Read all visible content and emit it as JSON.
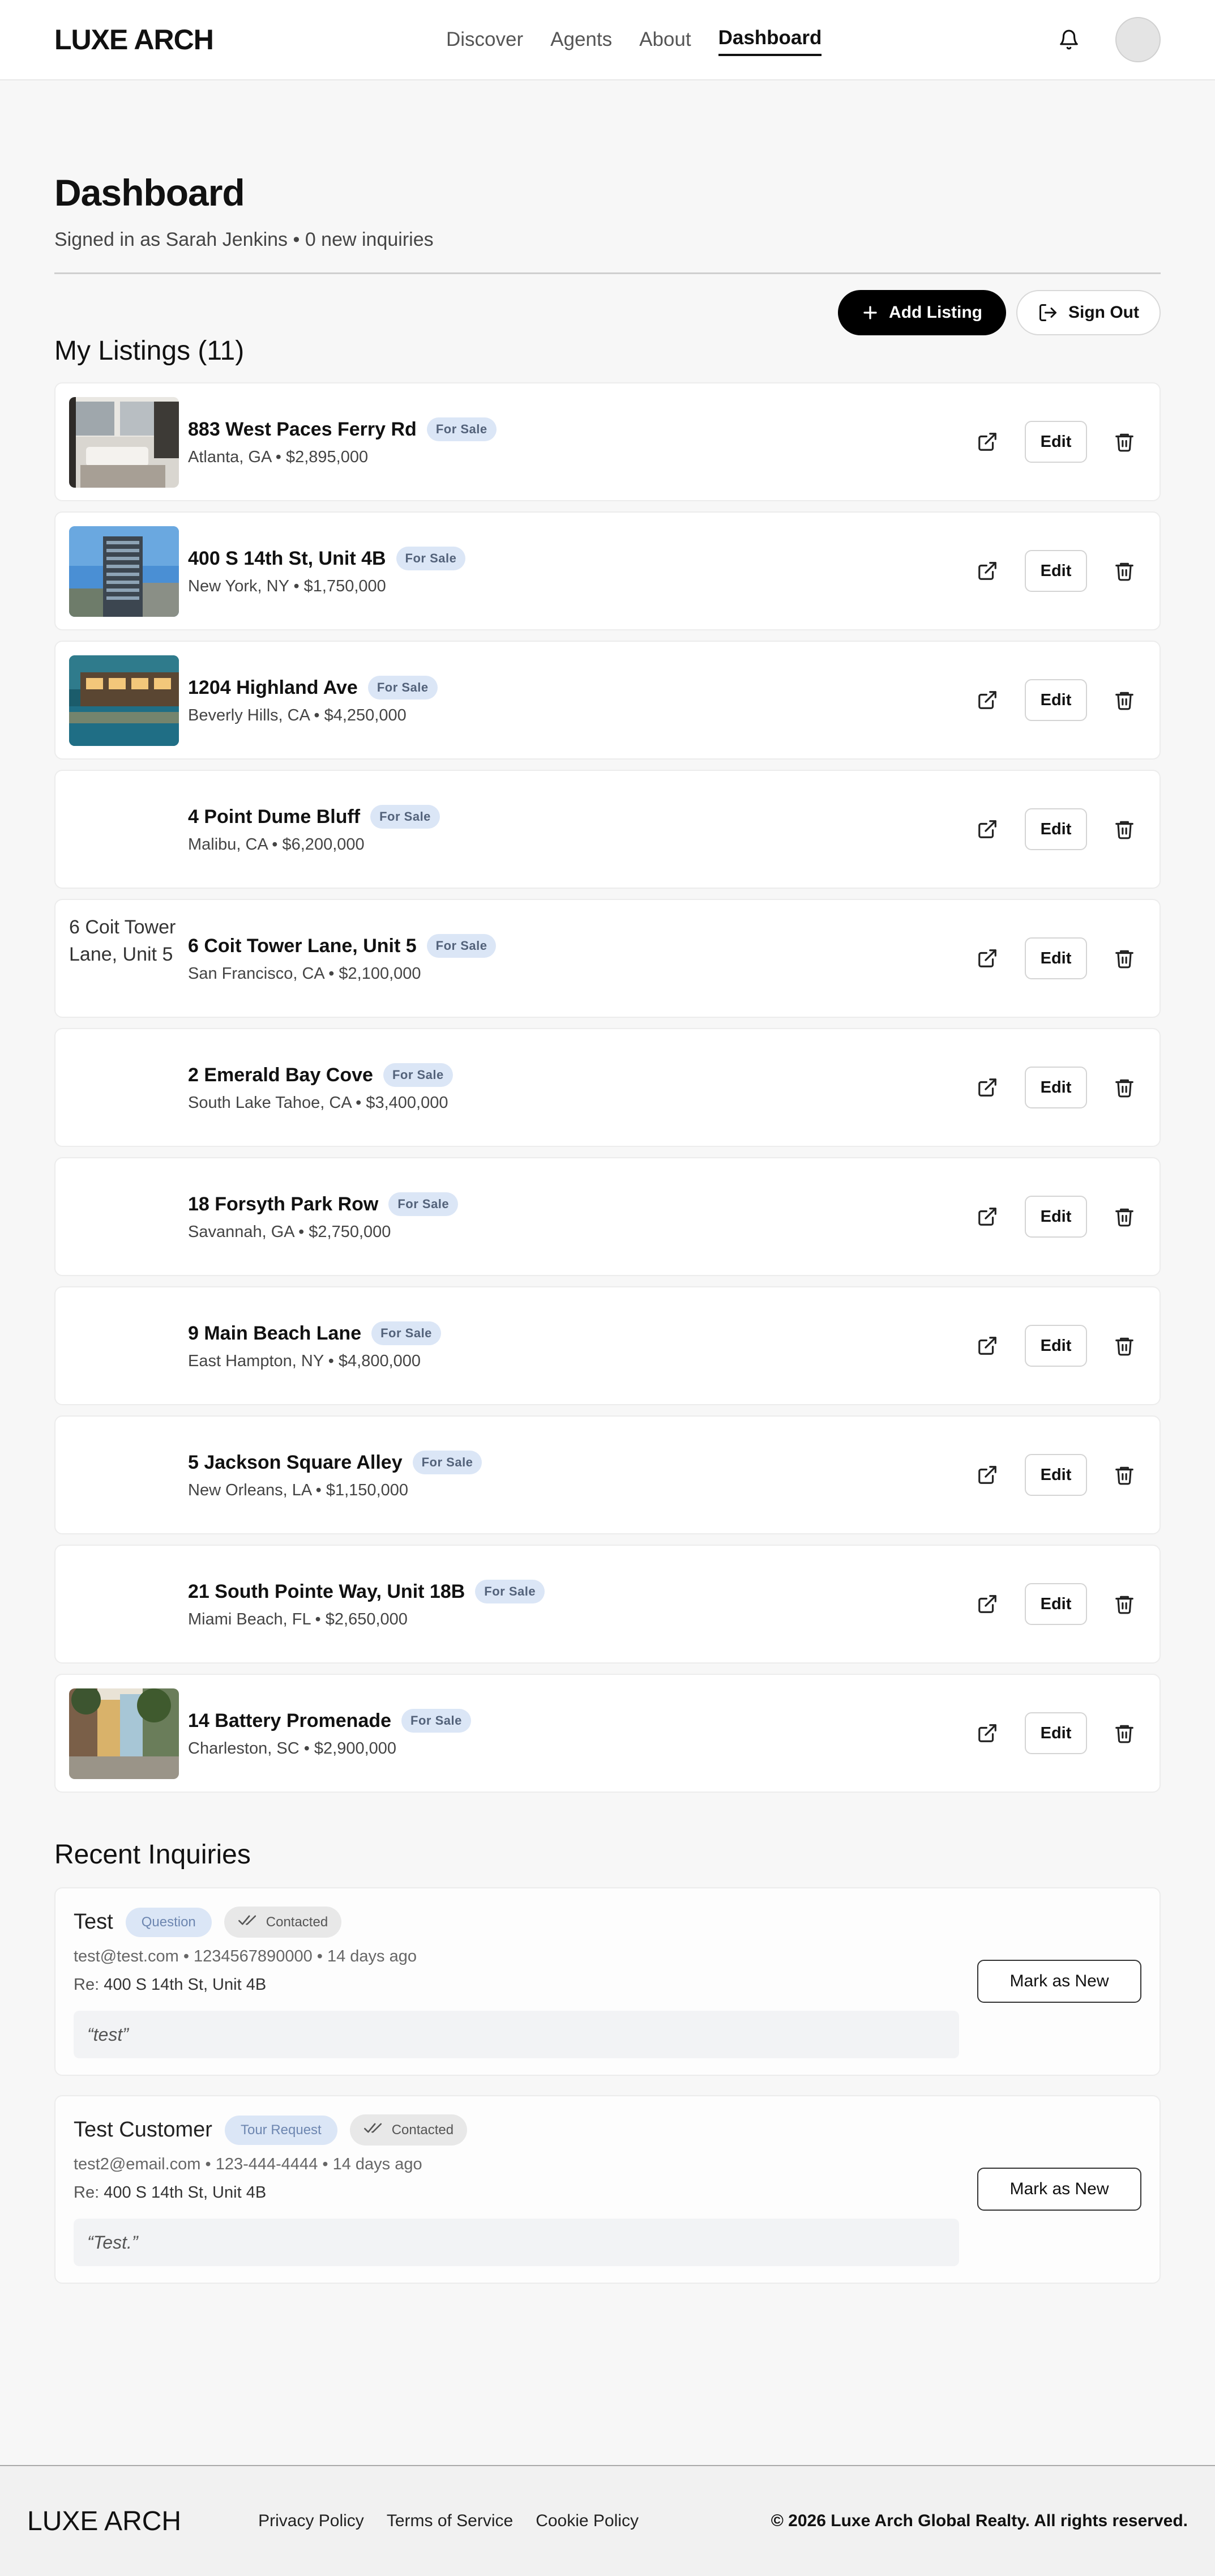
{
  "brand": "LUXE ARCH",
  "nav": {
    "items": [
      "Discover",
      "Agents",
      "About",
      "Dashboard"
    ],
    "active": "Dashboard"
  },
  "dashboard": {
    "title": "Dashboard",
    "subtitle": "Signed in as Sarah Jenkins • 0 new inquiries",
    "add_listing_label": "Add Listing",
    "sign_out_label": "Sign Out"
  },
  "listings_section": {
    "title": "My Listings (11)",
    "items": [
      {
        "title": "883 West Paces Ferry Rd",
        "badge": "For Sale",
        "meta": "Atlanta, GA • $2,895,000",
        "thumb": "interior"
      },
      {
        "title": "400 S 14th St, Unit 4B",
        "badge": "For Sale",
        "meta": "New York, NY • $1,750,000",
        "thumb": "tower"
      },
      {
        "title": "1204 Highland Ave",
        "badge": "For Sale",
        "meta": "Beverly Hills, CA • $4,250,000",
        "thumb": "pool"
      },
      {
        "title": "4 Point Dume Bluff",
        "badge": "For Sale",
        "meta": "Malibu, CA • $6,200,000",
        "thumb": "none"
      },
      {
        "title": "6 Coit Tower Lane, Unit 5",
        "badge": "For Sale",
        "meta": "San Francisco, CA • $2,100,000",
        "thumb": "broken",
        "alt": "6 Coit Tower Lane, Unit 5"
      },
      {
        "title": "2 Emerald Bay Cove",
        "badge": "For Sale",
        "meta": "South Lake Tahoe, CA • $3,400,000",
        "thumb": "none"
      },
      {
        "title": "18 Forsyth Park Row",
        "badge": "For Sale",
        "meta": "Savannah, GA • $2,750,000",
        "thumb": "none"
      },
      {
        "title": "9 Main Beach Lane",
        "badge": "For Sale",
        "meta": "East Hampton, NY • $4,800,000",
        "thumb": "none"
      },
      {
        "title": "5 Jackson Square Alley",
        "badge": "For Sale",
        "meta": "New Orleans, LA • $1,150,000",
        "thumb": "none"
      },
      {
        "title": "21 South Pointe Way, Unit 18B",
        "badge": "For Sale",
        "meta": "Miami Beach, FL • $2,650,000",
        "thumb": "none"
      },
      {
        "title": "14 Battery Promenade",
        "badge": "For Sale",
        "meta": "Charleston, SC • $2,900,000",
        "thumb": "street"
      }
    ],
    "edit_label": "Edit"
  },
  "inquiries_section": {
    "title": "Recent Inquiries",
    "items": [
      {
        "name": "Test",
        "type": "Question",
        "status": "Contacted",
        "contact": "test@test.com • 1234567890000 • 14 days ago",
        "re_label": "Re:",
        "re_value": "400 S 14th St, Unit 4B",
        "message": "“test”",
        "action": "Mark as New"
      },
      {
        "name": "Test Customer",
        "type": "Tour Request",
        "status": "Contacted",
        "contact": "test2@email.com • 123-444-4444 • 14 days ago",
        "re_label": "Re:",
        "re_value": "400 S 14th St, Unit 4B",
        "message": "“Test.”",
        "action": "Mark as New"
      }
    ]
  },
  "footer": {
    "brand": "LUXE ARCH",
    "links": [
      "Privacy Policy",
      "Terms of Service",
      "Cookie Policy"
    ],
    "copyright": "© 2026 Luxe Arch Global Realty. All rights reserved."
  }
}
